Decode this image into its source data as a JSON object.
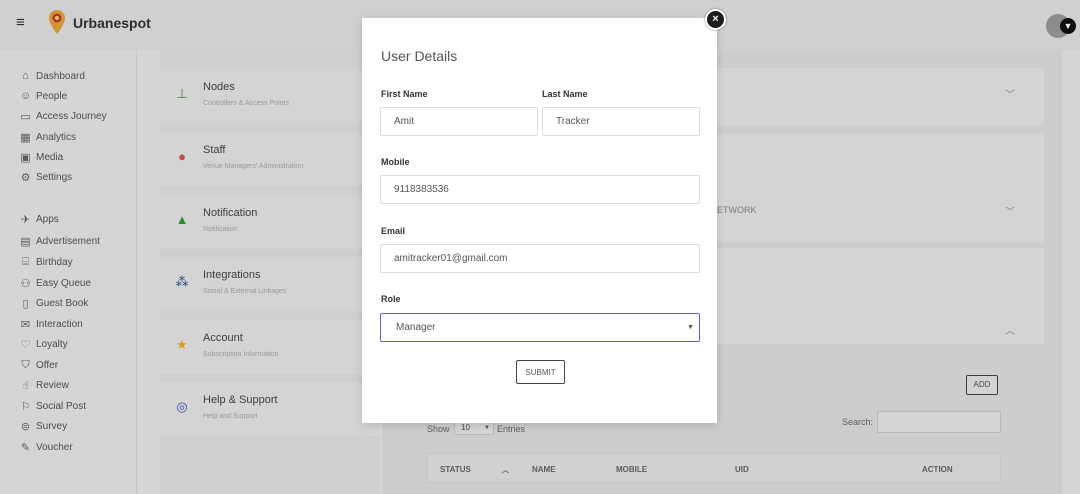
{
  "topbar": {
    "brand": "Urbanespot"
  },
  "sidebar": {
    "items": [
      {
        "label": "Dashboard",
        "icon": "⌂"
      },
      {
        "label": "People",
        "icon": "☺"
      },
      {
        "label": "Access Journey",
        "icon": "▭"
      },
      {
        "label": "Analytics",
        "icon": "▦"
      },
      {
        "label": "Media",
        "icon": "▣"
      },
      {
        "label": "Settings",
        "icon": "⚙"
      },
      {
        "label": "Apps",
        "icon": "✈"
      },
      {
        "label": "Advertisement",
        "icon": "▤"
      },
      {
        "label": "Birthday",
        "icon": "⌸"
      },
      {
        "label": "Easy Queue",
        "icon": "⚇"
      },
      {
        "label": "Guest Book",
        "icon": "▯"
      },
      {
        "label": "Interaction",
        "icon": "✉"
      },
      {
        "label": "Loyalty",
        "icon": "♡"
      },
      {
        "label": "Offer",
        "icon": "⛉"
      },
      {
        "label": "Review",
        "icon": "☝"
      },
      {
        "label": "Social Post",
        "icon": "⚐"
      },
      {
        "label": "Survey",
        "icon": "⊜"
      },
      {
        "label": "Voucher",
        "icon": "✎"
      }
    ]
  },
  "settings_cards": [
    {
      "title": "Nodes",
      "subtitle": "Controllers & Access Points",
      "color": "#3a9a3a"
    },
    {
      "title": "Staff",
      "subtitle": "Venue Managers' Administration",
      "color": "#d9534f"
    },
    {
      "title": "Notification",
      "subtitle": "Notification",
      "color": "#2e9e3e"
    },
    {
      "title": "Integrations",
      "subtitle": "Social & External Linkages",
      "color": "#2a4a8a"
    },
    {
      "title": "Account",
      "subtitle": "Subscription Information",
      "color": "#f0ad1e"
    },
    {
      "title": "Help & Support",
      "subtitle": "Help and Support",
      "color": "#3a5ac0"
    }
  ],
  "background": {
    "network_text": "ETWORK",
    "add_label": "ADD",
    "show_label": "Show",
    "entries_value": "10",
    "entries_label": "Entries",
    "search_label": "Search:",
    "table_headers": [
      "STATUS",
      "NAME",
      "MOBILE",
      "UID",
      "ACTION"
    ]
  },
  "modal": {
    "title": "User Details",
    "first_name_label": "First Name",
    "first_name_value": "Amit",
    "last_name_label": "Last Name",
    "last_name_value": "Tracker",
    "mobile_label": "Mobile",
    "mobile_value": "9118383536",
    "email_label": "Email",
    "email_value": "amitracker01@gmail.com",
    "role_label": "Role",
    "role_value": "Manager",
    "submit_label": "SUBMIT",
    "close_symbol": "×"
  },
  "colors": {
    "accent_focus": "#6a5cc7",
    "overlay_dim": "rgba(0,0,0,0.09)"
  }
}
